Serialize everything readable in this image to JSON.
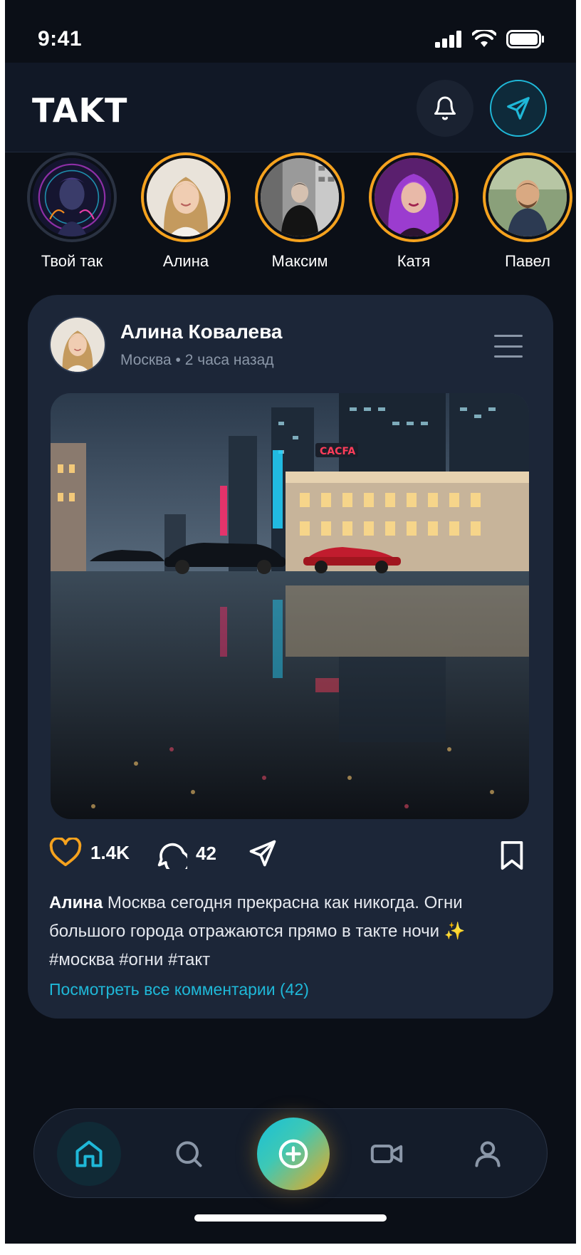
{
  "status_bar": {
    "time": "9:41"
  },
  "header": {
    "logo": "TAKT"
  },
  "stories": [
    {
      "name": "Твой так",
      "own": true
    },
    {
      "name": "Алина",
      "own": false
    },
    {
      "name": "Максим",
      "own": false
    },
    {
      "name": "Катя",
      "own": false
    },
    {
      "name": "Павел",
      "own": false
    }
  ],
  "post": {
    "author": "Алина Ковалева",
    "location": "Москва",
    "separator": "•",
    "time_ago": "2 часа назад",
    "likes": "1.4K",
    "comments": "42",
    "caption_author": "Алина",
    "caption_text": "Москва сегодня прекрасна как никогда. Огни большого города отражаются прямо в такте ночи ✨ #москва #огни #такт",
    "view_comments": "Посмотреть все комментарии (42)"
  },
  "colors": {
    "background": "#0b0f17",
    "card": "#1c2638",
    "accent_cyan": "#1fb8d8",
    "accent_orange": "#f5a21e"
  },
  "icons": [
    "bell-icon",
    "send-icon",
    "heart-icon",
    "comment-icon",
    "share-icon",
    "bookmark-icon",
    "home-icon",
    "search-icon",
    "plus-icon",
    "video-icon",
    "profile-icon"
  ]
}
